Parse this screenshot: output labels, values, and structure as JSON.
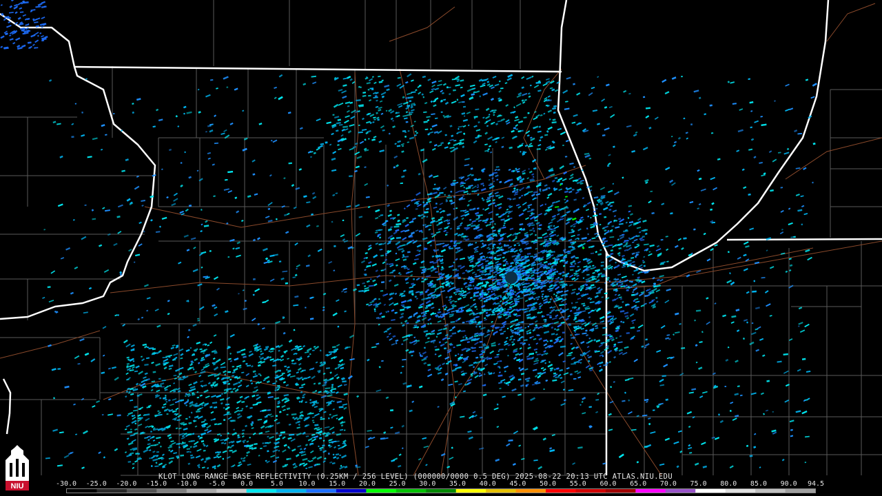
{
  "product": {
    "caption": "KLOT LONG RANGE BASE REFLECTIVITY (0.25KM / 256 LEVEL) (000000/0000 0.5 DEG) 2025-08-22 20:13 UTC  ATLAS.NIU.EDU"
  },
  "legend": {
    "scale_labels": [
      "-30.0",
      "-25.0",
      "-20.0",
      "-15.0",
      "-10.0",
      "-5.0",
      "0.0",
      "5.0",
      "10.0",
      "15.0",
      "20.0",
      "25.0",
      "30.0",
      "35.0",
      "40.0",
      "45.0",
      "50.0",
      "55.0",
      "60.0",
      "65.0",
      "70.0",
      "75.0",
      "80.0",
      "85.0",
      "90.0",
      "94.5"
    ],
    "scale_values": [
      -30,
      -25,
      -20,
      -15,
      -10,
      -5,
      0,
      5,
      10,
      15,
      20,
      25,
      30,
      35,
      40,
      45,
      50,
      55,
      60,
      65,
      70,
      75,
      80,
      85,
      90,
      94.5
    ],
    "range_dbz": [
      -30,
      94.5
    ],
    "colors": [
      "#000000",
      "#2a2a2a",
      "#555555",
      "#7f7f7f",
      "#a9a9a9",
      "#c8c8c8",
      "#00e5ee",
      "#00b2ee",
      "#1e6fff",
      "#0000cd",
      "#00ff00",
      "#00c000",
      "#008800",
      "#ffff00",
      "#e5c000",
      "#ff9000",
      "#ff0000",
      "#d00000",
      "#a00000",
      "#ff00ff",
      "#9955c9",
      "#ffffff",
      "#e0e0e0",
      "#c0c0c0",
      "#a0a0a0"
    ]
  },
  "map": {
    "radar_site": "KLOT",
    "state_border_color": "#ffffff",
    "county_line_color": "#5a5a5a",
    "road_color": "#8b4a2b",
    "echo_colors": [
      "#00e5ee",
      "#00b2ee",
      "#1e90ff",
      "#1e6fff",
      "#00ff00"
    ]
  },
  "logo": {
    "text": "NIU",
    "icon": "niu-tower-icon",
    "color": "#c8102e"
  }
}
